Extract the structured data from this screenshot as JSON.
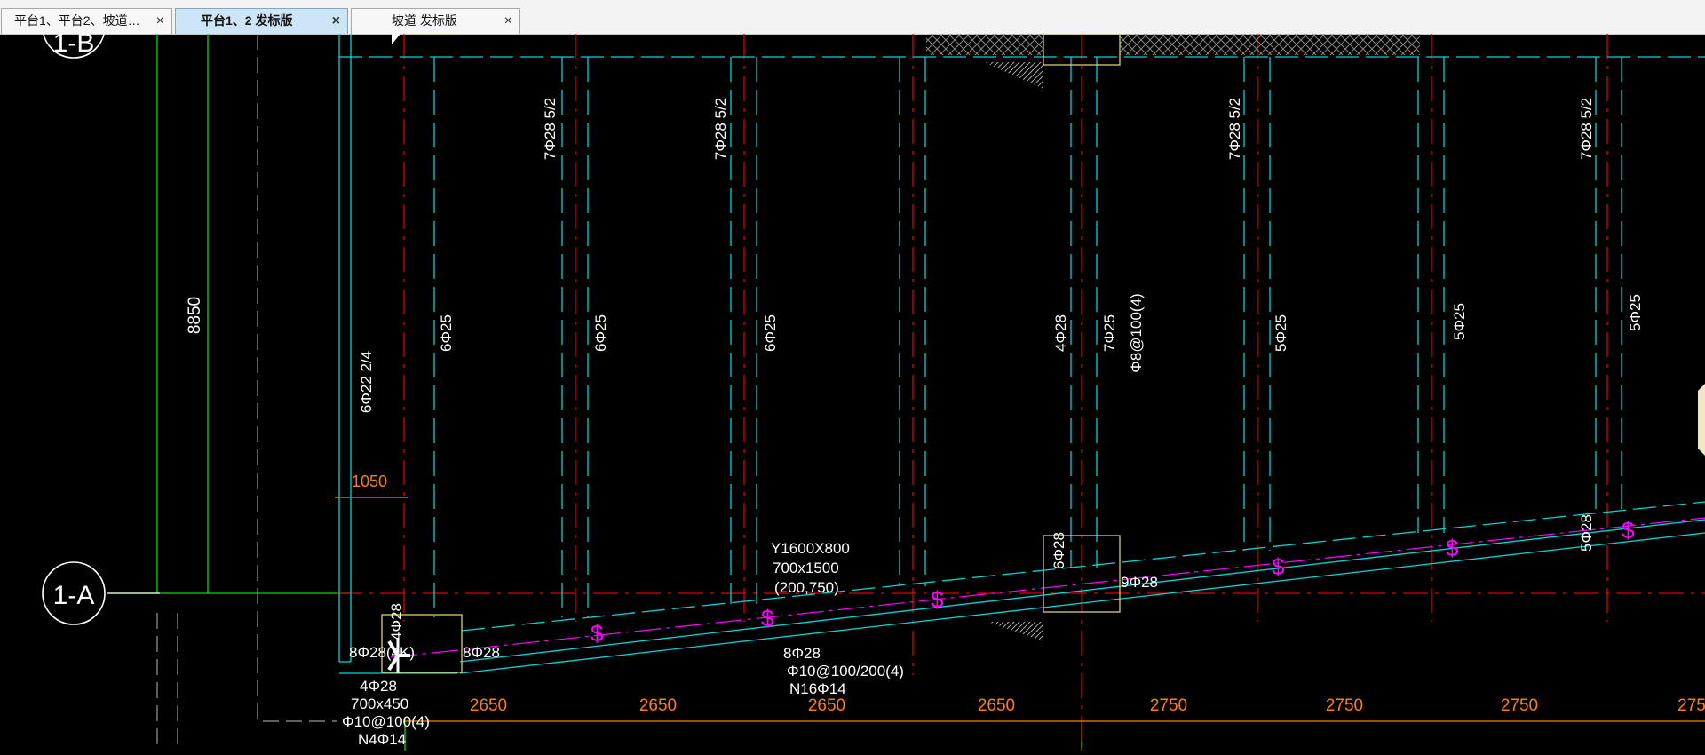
{
  "tabs": [
    {
      "label": "平台1、平台2、坡道…",
      "close": "×"
    },
    {
      "label": "平台1、2 发标版",
      "close": "×"
    },
    {
      "label": "坡道 发标版",
      "close": "×"
    }
  ],
  "axis": {
    "label_b": "1-B",
    "label_a": "1-A"
  },
  "dims": {
    "v8850": "8850",
    "d1050": "1050",
    "bottom": [
      "2650",
      "2650",
      "2650",
      "2650",
      "2750",
      "2750",
      "2750",
      "275"
    ]
  },
  "rebar": {
    "top_5_2": "7Φ28 5/2",
    "col_6_25": "6Φ25",
    "col_5_25": "5Φ25",
    "left_6_22": "6Φ22 2/4",
    "c4_28": "4Φ28",
    "c7_25": "7Φ25",
    "stirrup_8": "Φ8@100(4)",
    "c5_28": "5Φ28",
    "c6_28": "6Φ28",
    "c9_28": "9Φ28",
    "c8_28": "8Φ28",
    "c8_28_4k": "8Φ28(4K)",
    "c4_28_v": "4Φ28"
  },
  "beams": {
    "y1600": "Y1600X800",
    "b700x1500": "700x1500",
    "elev": "(200,750)",
    "mid_8_28": "8Φ28",
    "mid_stirrup": "Φ10@100/200(4)",
    "mid_n16": "N16Φ14",
    "left_4_28": "4Φ28",
    "left_700x450": "700x450",
    "left_stirrup": "Φ10@100(4)",
    "left_n4": "N4Φ14"
  },
  "markers": {
    "dollar": "$"
  },
  "colors": {
    "bg": "#000000",
    "cyan": "#00d5d5",
    "red": "#e00000",
    "green": "#00dd00",
    "orange": "#ff8000",
    "magenta": "#ff00ff",
    "white": "#ffffff",
    "yellow": "#d8d070"
  }
}
